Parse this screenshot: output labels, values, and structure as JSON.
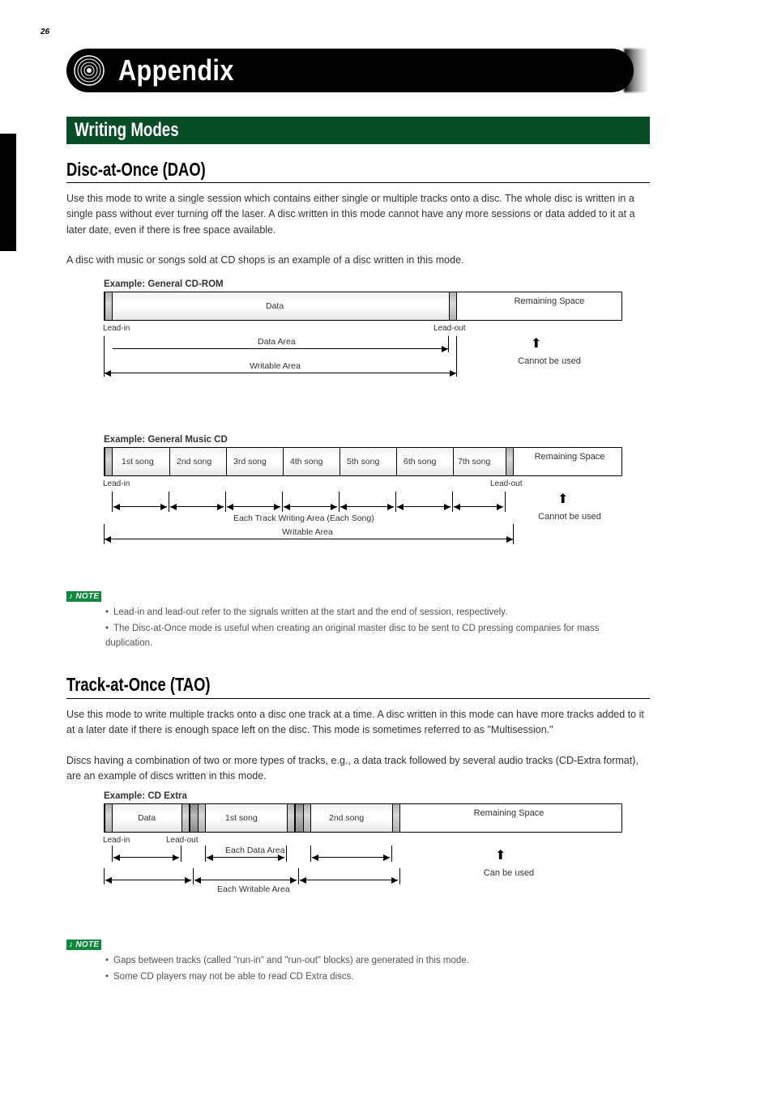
{
  "page_number": "26",
  "header_title": "Appendix",
  "section1_title": "Writing Modes",
  "dao": {
    "heading": "Disc-at-Once (DAO)",
    "para1": "Use this mode to write a single session which contains either single or multiple tracks onto a disc. The whole disc is written in a single pass without ever turning off the laser. A disc written in this mode cannot have any more sessions or data added to it at a later date, even if there is free space available.",
    "para2": "A disc with music or songs sold at CD shops is an example of a disc written in this mode.",
    "d1_title": "Example: General CD-ROM",
    "d1_data_label": "Data",
    "d1_remain": "Remaining Space",
    "d1_cannot": "Cannot be used",
    "d1_data_area": "Data Area",
    "d1_writable": "Writable Area",
    "d2_title": "Example: General Music CD",
    "d2_tracks": [
      "1st song",
      "2nd song",
      "3rd song",
      "4th song",
      "5th song",
      "6th song",
      "7th song"
    ],
    "d2_remain": "Remaining Space",
    "d2_cannot": "Cannot be used",
    "d2_each": "Each Track Writing Area (Each Song)",
    "d2_writable": "Writable Area",
    "notes": [
      "Lead-in and lead-out refer to the signals written at the start and the end of session, respectively.",
      "The Disc-at-Once mode is useful when creating an original master disc to be sent to CD pressing companies for mass duplication."
    ]
  },
  "tao": {
    "heading": "Track-at-Once (TAO)",
    "para1": "Use this mode to write multiple tracks onto a disc one track at a time. A disc written in this mode can have more tracks added to it at a later date if there is enough space left on the disc. This mode is sometimes referred to as \"Multisession.\"",
    "para2": "Discs having a combination of two or more types of tracks, e.g., a data track followed by several audio tracks (CD-Extra format), are an example of discs written in this mode.",
    "d_title": "Example: CD Extra",
    "d_segments": [
      "Data",
      "1st song",
      "2nd song"
    ],
    "d_remain": "Remaining Space",
    "d_can": "Can be used",
    "d_each": "Each Data Area",
    "d_writable": "Each Writable Area",
    "notes": [
      "Gaps between tracks (called \"run-in\" and \"run-out\" blocks) are generated in this mode.",
      "Some CD players may not be able to read CD Extra discs."
    ]
  },
  "lead_in": "Lead-in",
  "lead_out": "Lead-out"
}
